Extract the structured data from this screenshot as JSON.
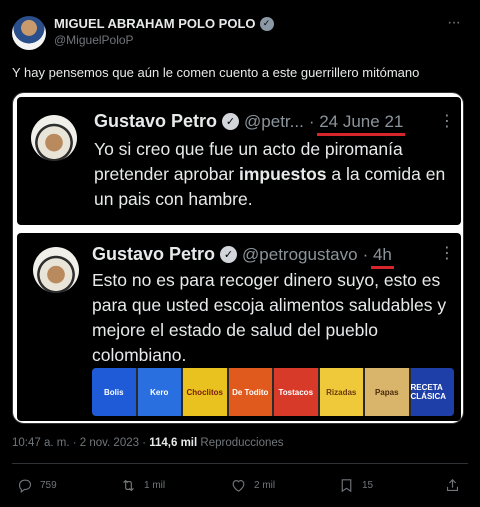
{
  "author": {
    "name": "MIGUEL ABRAHAM POLO POLO",
    "handle": "@MiguelPoloP"
  },
  "tweet_text": "Y hay pensemos que aún le comen cuento a este guerrillero mitómano",
  "quoted": [
    {
      "name": "Gustavo Petro",
      "handle": "@petr...",
      "date": "24 June 21",
      "text_before": "Yo si creo que fue un acto de piromanía pretender aprobar ",
      "text_bold": "impuestos",
      "text_after": " a la comida en un pais con hambre."
    },
    {
      "name": "Gustavo Petro",
      "handle": "@petrogustavo",
      "date": "4h",
      "text": "Esto no es para recoger dinero suyo, esto es para que usted escoja alimentos saludables y mejore el estado de salud del pueblo colombiano."
    }
  ],
  "shelf_labels": [
    "Bolis",
    "Kero",
    "Choclitos",
    "De Todito",
    "Tostacos",
    "Rizadas",
    "Papas",
    "RECETA CLÁSICA"
  ],
  "meta": {
    "time": "10:47 a. m. · 2 nov. 2023 · ",
    "views": "114,6 mil",
    "views_label": " Reproducciones"
  },
  "actions": {
    "replies": "759",
    "reposts": "1 mil",
    "likes": "2 mil",
    "bookmarks": "15"
  },
  "colors": {
    "background": "#000000",
    "text": "#e7e9ea",
    "muted": "#71767b",
    "underline": "#d6262b"
  }
}
